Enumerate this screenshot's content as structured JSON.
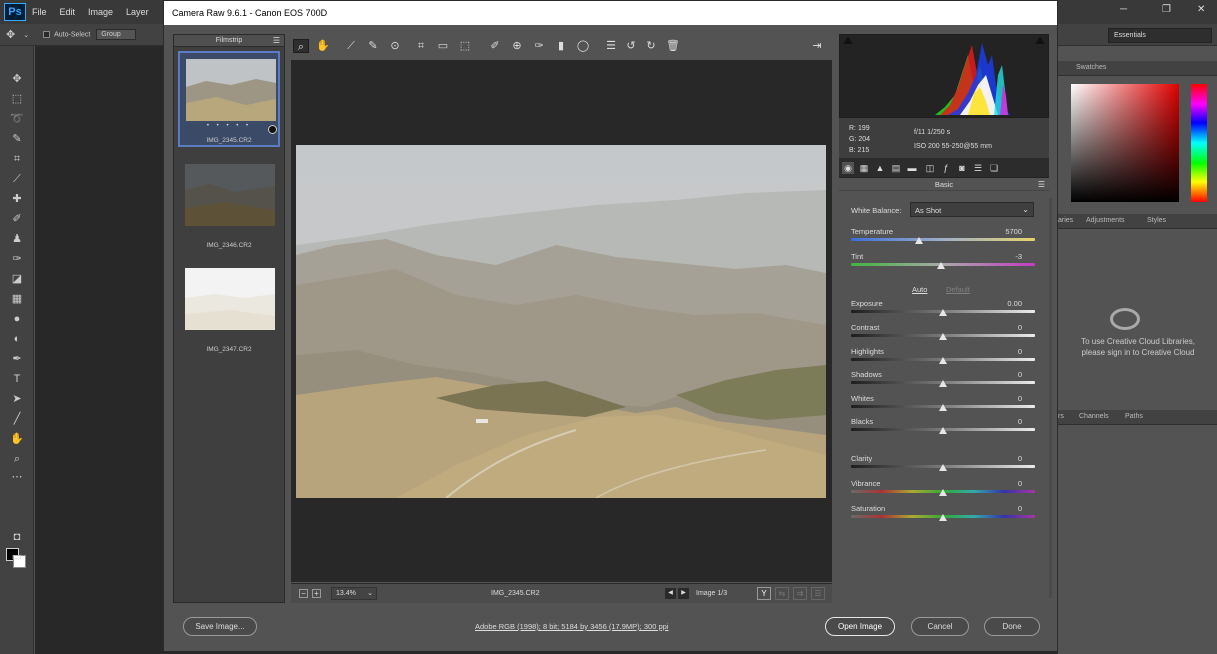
{
  "photoshop": {
    "logo": "Ps",
    "menu": [
      "File",
      "Edit",
      "Image",
      "Layer"
    ],
    "options": {
      "auto_select": "Auto-Select",
      "group": "Group"
    },
    "workspace": "Essentials",
    "right_tabs_top": {
      "swatches": "Swatches"
    },
    "right_tabs_mid": {
      "libraries": "aries",
      "adjustments": "Adjustments",
      "styles": "Styles"
    },
    "cc_message_line1": "To use Creative Cloud Libraries,",
    "cc_message_line2": "please sign in to Creative Cloud",
    "right_tabs_low": {
      "layers": "rs",
      "channels": "Channels",
      "paths": "Paths"
    }
  },
  "camera_raw": {
    "title": "Camera Raw 9.6.1  -  Canon EOS 700D",
    "filmstrip": {
      "title": "Filmstrip",
      "items": [
        {
          "name": "IMG_2345.CR2",
          "selected": true,
          "stars": "• • • • •"
        },
        {
          "name": "IMG_2346.CR2",
          "selected": false
        },
        {
          "name": "IMG_2347.CR2",
          "selected": false
        }
      ]
    },
    "preview": {
      "zoom": "13.4%",
      "filename": "IMG_2345.CR2",
      "image_count": "Image 1/3",
      "view_y": "Y"
    },
    "info": {
      "r": "R:  199",
      "g": "G:  204",
      "b": "B:  215",
      "aperture_shutter": "f/11    1/250 s",
      "iso_lens": "ISO 200    55-250@55 mm"
    },
    "basic": {
      "title": "Basic",
      "white_balance_label": "White Balance:",
      "white_balance_value": "As Shot",
      "auto": "Auto",
      "default": "Default",
      "sliders": [
        {
          "label": "Temperature",
          "value": "5700",
          "pos": 0.37,
          "track": "temp"
        },
        {
          "label": "Tint",
          "value": "-3",
          "pos": 0.49,
          "track": "tint"
        },
        {
          "label": "Exposure",
          "value": "0.00",
          "pos": 0.5,
          "track": "gray"
        },
        {
          "label": "Contrast",
          "value": "0",
          "pos": 0.5,
          "track": "gray"
        },
        {
          "label": "Highlights",
          "value": "0",
          "pos": 0.5,
          "track": "gray"
        },
        {
          "label": "Shadows",
          "value": "0",
          "pos": 0.5,
          "track": "gray"
        },
        {
          "label": "Whites",
          "value": "0",
          "pos": 0.5,
          "track": "gray"
        },
        {
          "label": "Blacks",
          "value": "0",
          "pos": 0.5,
          "track": "gray"
        },
        {
          "label": "Clarity",
          "value": "0",
          "pos": 0.5,
          "track": "gray"
        },
        {
          "label": "Vibrance",
          "value": "0",
          "pos": 0.5,
          "track": "color"
        },
        {
          "label": "Saturation",
          "value": "0",
          "pos": 0.5,
          "track": "color"
        }
      ]
    },
    "footer": {
      "save_label": "Save Image...",
      "workflow_info": "Adobe RGB (1998); 8 bit; 5184 by 3456 (17.9MP); 300 ppi",
      "open_label": "Open Image",
      "cancel_label": "Cancel",
      "done_label": "Done"
    }
  }
}
